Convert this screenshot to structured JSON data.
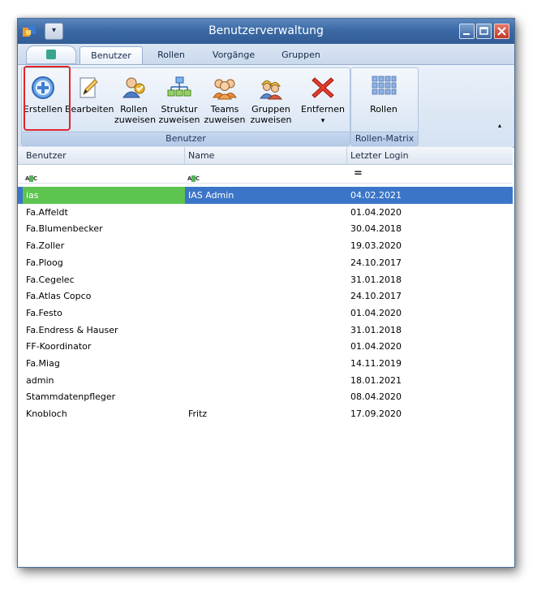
{
  "window": {
    "title": "Benutzerverwaltung",
    "qat_glyph": "▾"
  },
  "tabs": [
    "Benutzer",
    "Rollen",
    "Vorgänge",
    "Gruppen"
  ],
  "ribbon": {
    "groups": [
      {
        "label": "Benutzer"
      },
      {
        "label": "Rollen-Matrix"
      }
    ],
    "buttons": {
      "erstellen": "Erstellen",
      "bearbeiten": "Bearbeiten",
      "rollen_zuweisen_1": "Rollen",
      "rollen_zuweisen_2": "zuweisen",
      "struktur_zuweisen_1": "Struktur",
      "struktur_zuweisen_2": "zuweisen",
      "teams_zuweisen_1": "Teams",
      "teams_zuweisen_2": "zuweisen",
      "gruppen_zuweisen_1": "Gruppen",
      "gruppen_zuweisen_2": "zuweisen",
      "entfernen": "Entfernen",
      "entfernen_arrow": "▾",
      "rollen": "Rollen"
    },
    "collapse": "▴"
  },
  "grid": {
    "columns": [
      "Benutzer",
      "Name",
      "Letzter Login"
    ],
    "filter": {
      "text_op_1": "ABC",
      "text_op_2": "ABC",
      "date_op": "="
    },
    "rows": [
      {
        "benutzer": "ias",
        "name": "IAS Admin",
        "login": "04.02.2021"
      },
      {
        "benutzer": "Fa.Affeldt",
        "name": "",
        "login": "01.04.2020"
      },
      {
        "benutzer": "Fa.Blumenbecker",
        "name": "",
        "login": "30.04.2018"
      },
      {
        "benutzer": "Fa.Zoller",
        "name": "",
        "login": "19.03.2020"
      },
      {
        "benutzer": "Fa.Ploog",
        "name": "",
        "login": "24.10.2017"
      },
      {
        "benutzer": "Fa.Cegelec",
        "name": "",
        "login": "31.01.2018"
      },
      {
        "benutzer": "Fa.Atlas Copco",
        "name": "",
        "login": "24.10.2017"
      },
      {
        "benutzer": "Fa.Festo",
        "name": "",
        "login": "01.04.2020"
      },
      {
        "benutzer": "Fa.Endress & Hauser",
        "name": "",
        "login": "31.01.2018"
      },
      {
        "benutzer": "FF-Koordinator",
        "name": "",
        "login": "01.04.2020"
      },
      {
        "benutzer": "Fa.Miag",
        "name": "",
        "login": "14.11.2019"
      },
      {
        "benutzer": "admin",
        "name": "",
        "login": "18.01.2021"
      },
      {
        "benutzer": "Stammdatenpfleger",
        "name": "",
        "login": "08.04.2020"
      },
      {
        "benutzer": "Knobloch",
        "name": "Fritz",
        "login": "17.09.2020"
      }
    ],
    "selected_index": 0
  },
  "colors": {
    "titlebar": "#3c6aa6",
    "selection": "#3b75c7",
    "selection_first_cell": "#5cc44f",
    "highlight_box": "#e0242a"
  }
}
